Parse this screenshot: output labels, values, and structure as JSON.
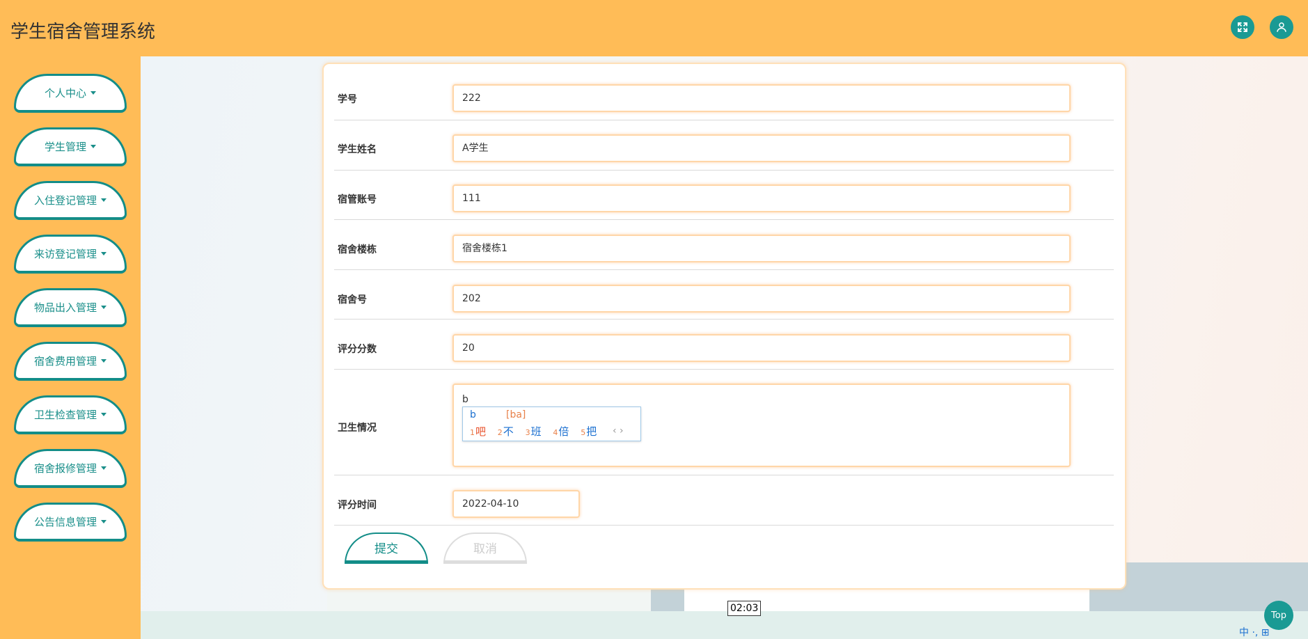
{
  "header": {
    "title": "学生宿舍管理系统",
    "fullscreen_icon": "expand-icon",
    "user_icon": "user-icon",
    "accent": "#ffbc57",
    "teal": "#1a9a94"
  },
  "sidebar": {
    "items": [
      {
        "label": "个人中心"
      },
      {
        "label": "学生管理"
      },
      {
        "label": "入住登记管理"
      },
      {
        "label": "来访登记管理"
      },
      {
        "label": "物品出入管理"
      },
      {
        "label": "宿舍费用管理"
      },
      {
        "label": "卫生检查管理"
      },
      {
        "label": "宿舍报修管理"
      },
      {
        "label": "公告信息管理"
      }
    ]
  },
  "form": {
    "fields": [
      {
        "label": "学号",
        "value": "222"
      },
      {
        "label": "学生姓名",
        "value": "A学生"
      },
      {
        "label": "宿管账号",
        "value": "111"
      },
      {
        "label": "宿舍楼栋",
        "value": "宿舍楼栋1"
      },
      {
        "label": "宿舍号",
        "value": "202"
      },
      {
        "label": "评分分数",
        "value": "20"
      },
      {
        "label": "卫生情况",
        "value": "b"
      },
      {
        "label": "评分时间",
        "value": "2022-04-10"
      }
    ],
    "submit_label": "提交",
    "cancel_label": "取消"
  },
  "ime": {
    "composition": "b",
    "pinyin": "[ba]",
    "candidates": [
      {
        "num": "1",
        "char": "吧"
      },
      {
        "num": "2",
        "char": "不"
      },
      {
        "num": "3",
        "char": "班"
      },
      {
        "num": "4",
        "char": "倍"
      },
      {
        "num": "5",
        "char": "把"
      }
    ],
    "arrows": "‹ ›"
  },
  "overlay": {
    "timer": "02:03",
    "top_label": "Top",
    "tray": "中 ·, ⊞"
  }
}
